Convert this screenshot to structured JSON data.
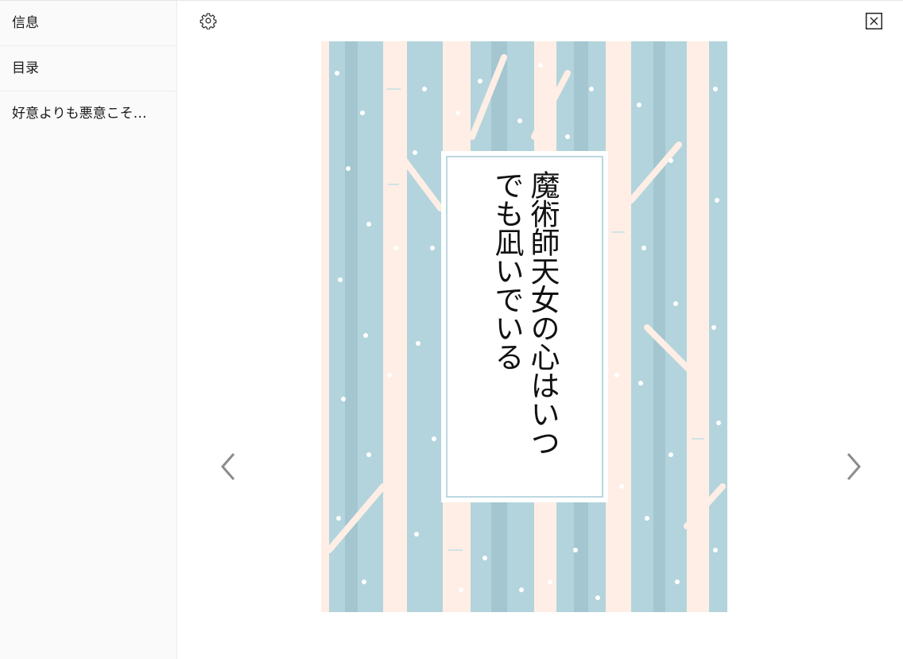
{
  "sidebar": {
    "items": [
      {
        "label": "信息"
      },
      {
        "label": "目录"
      },
      {
        "label": "好意よりも悪意こそ…"
      }
    ]
  },
  "toolbar": {
    "settings_icon": "gear-icon",
    "close_icon": "close-icon"
  },
  "reader": {
    "prev_icon": "chevron-left-icon",
    "next_icon": "chevron-right-icon",
    "cover": {
      "title_line1": "魔術師天女の心はいつ",
      "title_line2": "でも凪いでいる"
    }
  },
  "colors": {
    "cover_blue": "#b3d4dc",
    "cover_pink": "#ffeee5",
    "frame_border": "#bcd8e0"
  }
}
